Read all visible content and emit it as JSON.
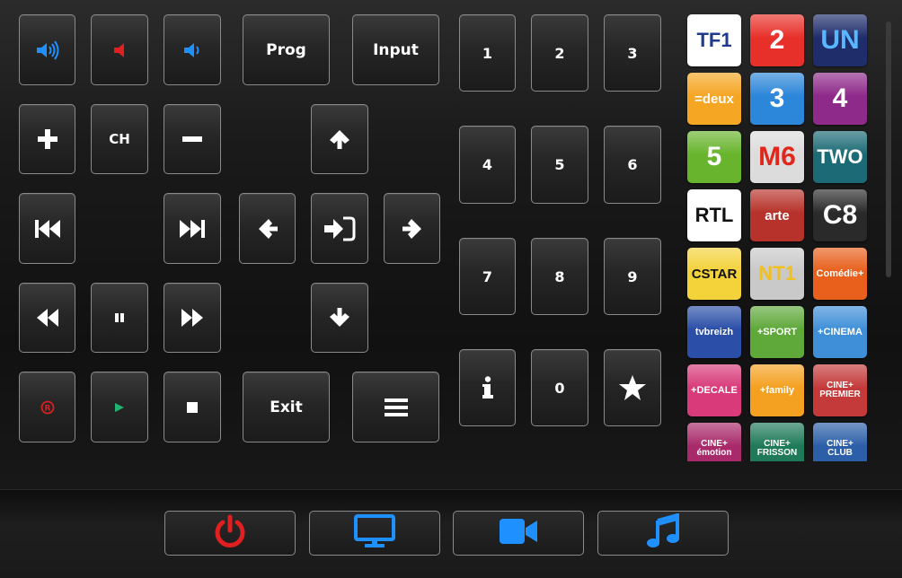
{
  "colors": {
    "accent_blue": "#1e90ff",
    "mute_red": "#e02020",
    "record_red": "#d92020",
    "play_green": "#21b573",
    "power_red": "#e02020"
  },
  "volume": {
    "up_icon": "volume-up-icon",
    "mute_icon": "volume-mute-icon",
    "down_icon": "volume-down-icon"
  },
  "labels": {
    "prog": "Prog",
    "input": "Input",
    "ch": "CH",
    "exit": "Exit"
  },
  "numpad": [
    "1",
    "2",
    "3",
    "4",
    "5",
    "6",
    "7",
    "8",
    "9",
    "0"
  ],
  "channels": [
    {
      "name": "TF1",
      "text": "TF1",
      "bg": "#ffffff",
      "fg": "#1f3b8c"
    },
    {
      "name": "France 2",
      "text": "2",
      "bg": "#e8302a",
      "fg": "#ffffff"
    },
    {
      "name": "France 4 Uni",
      "text": "UN",
      "bg": "#1f2d6b",
      "fg": "#58b7ff"
    },
    {
      "name": "Deux",
      "text": "=deux",
      "bg": "#f5a623",
      "fg": "#ffffff"
    },
    {
      "name": "France 3",
      "text": "3",
      "bg": "#2c86d9",
      "fg": "#ffffff"
    },
    {
      "name": "France 4",
      "text": "4",
      "bg": "#8e2a8a",
      "fg": "#ffffff"
    },
    {
      "name": "France 5",
      "text": "5",
      "bg": "#68b52d",
      "fg": "#ffffff"
    },
    {
      "name": "M6",
      "text": "M6",
      "bg": "#dcdcdc",
      "fg": "#e1261c"
    },
    {
      "name": "BBC Two",
      "text": "TWO",
      "bg": "#1b6a75",
      "fg": "#ffffff"
    },
    {
      "name": "RTL",
      "text": "RTL",
      "bg": "#ffffff",
      "fg": "#111111"
    },
    {
      "name": "Arte",
      "text": "arte",
      "bg": "#b7322a",
      "fg": "#ffffff"
    },
    {
      "name": "C8",
      "text": "C8",
      "bg": "#2a2a2a",
      "fg": "#ffffff"
    },
    {
      "name": "CStar",
      "text": "CSTAR",
      "bg": "#f3d23a",
      "fg": "#111111"
    },
    {
      "name": "NT1",
      "text": "NT1",
      "bg": "#c9c9c9",
      "fg": "#f0c020"
    },
    {
      "name": "Comedie",
      "text": "Comédie+",
      "bg": "#e8601c",
      "fg": "#ffffff"
    },
    {
      "name": "TV Breizh",
      "text": "tvbreizh",
      "bg": "#2b4fa8",
      "fg": "#ffffff"
    },
    {
      "name": "Sport",
      "text": "+SPORT",
      "bg": "#5fa83a",
      "fg": "#ffffff"
    },
    {
      "name": "Cinema",
      "text": "+CINEMA",
      "bg": "#3f8fd8",
      "fg": "#ffffff"
    },
    {
      "name": "Decale",
      "text": "+DECALE",
      "bg": "#d83a7a",
      "fg": "#ffffff"
    },
    {
      "name": "Family",
      "text": "+family",
      "bg": "#f4a020",
      "fg": "#ffffff"
    },
    {
      "name": "Premier",
      "text": "CINE+ PREMIER",
      "bg": "#c43a3a",
      "fg": "#ffffff"
    },
    {
      "name": "Emotion",
      "text": "CINE+ émotion",
      "bg": "#a82a6a",
      "fg": "#ffffff"
    },
    {
      "name": "Frisson",
      "text": "CINE+ FRISSON",
      "bg": "#1f7a5a",
      "fg": "#ffffff"
    },
    {
      "name": "Club",
      "text": "CINE+ CLUB",
      "bg": "#2c5fa8",
      "fg": "#ffffff"
    }
  ],
  "bottom": {
    "power_icon": "power-icon",
    "tv_icon": "monitor-icon",
    "video_icon": "video-camera-icon",
    "music_icon": "music-note-icon"
  }
}
